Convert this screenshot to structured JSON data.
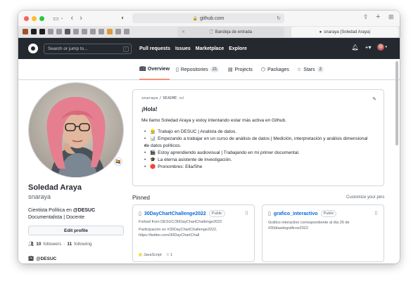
{
  "browser": {
    "url": "github.com",
    "tabs": [
      {
        "label": "Bandeja de entrada"
      },
      {
        "label": "snaraya (Soledad Araya)"
      }
    ],
    "icons": [
      "sidebar-icon",
      "back-icon",
      "forward-icon",
      "shield-icon",
      "lock-icon",
      "reload-icon",
      "share-icon",
      "new-tab-icon",
      "tab-overview-icon"
    ]
  },
  "header": {
    "search_placeholder": "Search or jump to...",
    "search_shortcut": "/",
    "nav": [
      "Pull requests",
      "Issues",
      "Marketplace",
      "Explore"
    ],
    "plus": "+▾"
  },
  "profile_tabs": [
    {
      "label": "Overview",
      "icon": "book-icon",
      "active": true
    },
    {
      "label": "Repositories",
      "count": "21",
      "icon": "repo-icon"
    },
    {
      "label": "Projects",
      "icon": "project-icon"
    },
    {
      "label": "Packages",
      "icon": "package-icon"
    },
    {
      "label": "Stars",
      "count": "2",
      "icon": "star-icon"
    }
  ],
  "profile": {
    "name": "Soledad Araya",
    "login": "snaraya",
    "bio_line1_prefix": "Cientista Política en ",
    "bio_line1_org": "@DESUC",
    "bio_line2": "Documentalista | Docente",
    "edit_label": "Edit profile",
    "followers": "10",
    "followers_label": "followers",
    "dot": "·",
    "following": "11",
    "following_label": "following",
    "org": "@DESUC",
    "status_emoji": "🏳️‍🌈"
  },
  "readme": {
    "path_user": "snaraya",
    "path_sep": "/",
    "path_file": "README",
    "path_ext": ".md",
    "heading": "¡Hola!",
    "intro": "Me llamo Soledad Araya y estoy intentando estar más activa en Github.",
    "items": [
      {
        "emoji": "👷",
        "text": "Trabajo en DESUC | Analista de datos."
      },
      {
        "emoji": "📊",
        "text": "Empezando a trabajar en un curso de análisis de datos | Medición, interpretación y análisis dimensional"
      },
      {
        "emoji": "",
        "text": "de datos políticos."
      },
      {
        "emoji": "🎬",
        "text": "Estoy aprendiendo audiovisual | Trabajando en mi primer documental."
      },
      {
        "emoji": "🎓",
        "text": "La eterna asistente de investigación."
      },
      {
        "emoji": "🔴",
        "text": "Pronombres: Ella/She"
      }
    ]
  },
  "pinned": {
    "title": "Pinned",
    "customize": "Customize your pins",
    "cards": [
      {
        "name": "30DayChartChallenge2022",
        "visibility": "Public",
        "fork_note": "Forked from DESUC/30DayChartChallenge2022",
        "desc_line1": "Participación en #30DayChartChallenge2022,",
        "desc_line2": "https://twitter.com/30DayChartChall",
        "language": "JavaScript",
        "language_color": "#f1e05a",
        "stars": "1"
      },
      {
        "name": "grafico_interactivo",
        "visibility": "Public",
        "desc_line1": "Gráfico interactivo correspondiente al día 26 de",
        "desc_line2": "#30diasdegráficos2022"
      }
    ]
  }
}
